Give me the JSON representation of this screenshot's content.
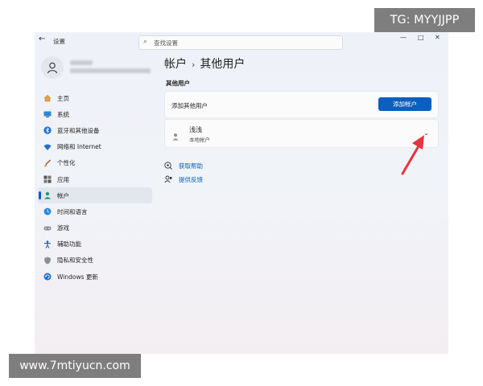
{
  "window": {
    "app_title": "设置",
    "search_placeholder": "查找设置",
    "controls": {
      "minimize": "—",
      "maximize": "□",
      "close": "✕"
    }
  },
  "sidebar": {
    "items": [
      {
        "label": "主页",
        "icon": "home-icon"
      },
      {
        "label": "系统",
        "icon": "system-icon"
      },
      {
        "label": "蓝牙和其他设备",
        "icon": "bluetooth-icon"
      },
      {
        "label": "网络和 Internet",
        "icon": "network-icon"
      },
      {
        "label": "个性化",
        "icon": "personalization-icon"
      },
      {
        "label": "应用",
        "icon": "apps-icon"
      },
      {
        "label": "帐户",
        "icon": "accounts-icon",
        "selected": true
      },
      {
        "label": "时间和语言",
        "icon": "time-language-icon"
      },
      {
        "label": "游戏",
        "icon": "gaming-icon"
      },
      {
        "label": "辅助功能",
        "icon": "accessibility-icon"
      },
      {
        "label": "隐私和安全性",
        "icon": "privacy-icon"
      },
      {
        "label": "Windows 更新",
        "icon": "windows-update-icon"
      }
    ]
  },
  "main": {
    "breadcrumb": {
      "parent": "帐户",
      "separator": "›",
      "current": "其他用户"
    },
    "section_header": "其他用户",
    "add_user": {
      "label": "添加其他用户",
      "button": "添加帐户"
    },
    "user": {
      "name": "浅浅",
      "type": "本地帐户"
    },
    "links": [
      {
        "label": "获取帮助",
        "icon": "help-icon"
      },
      {
        "label": "提供反馈",
        "icon": "feedback-icon"
      }
    ]
  },
  "watermarks": {
    "tg": "TG: MYYJJPP",
    "url": "www.7mtiyucn.com"
  },
  "colors": {
    "accent": "#0a5fbf",
    "annotation_arrow": "#e8343c"
  }
}
